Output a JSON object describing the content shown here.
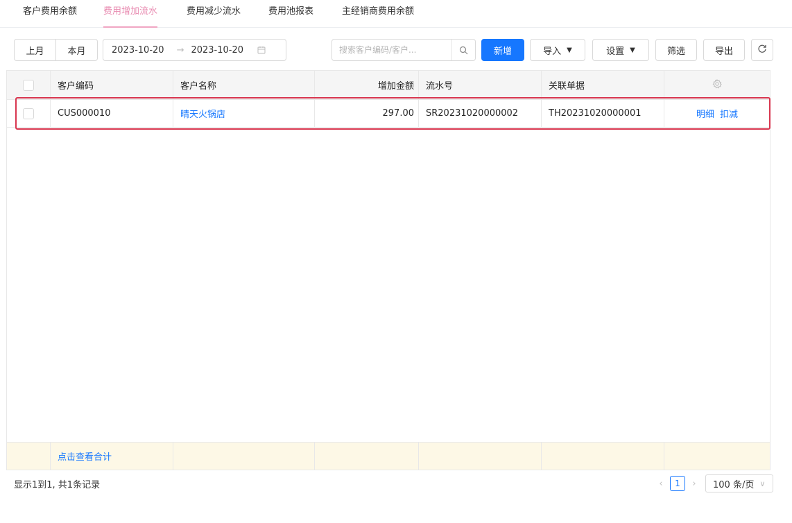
{
  "tabs": [
    {
      "label": "客户费用余额",
      "active": false
    },
    {
      "label": "费用增加流水",
      "active": true
    },
    {
      "label": "费用减少流水",
      "active": false
    },
    {
      "label": "费用池报表",
      "active": false
    },
    {
      "label": "主经销商费用余额",
      "active": false
    }
  ],
  "toolbar": {
    "prev_month": "上月",
    "this_month": "本月",
    "date_start": "2023-10-20",
    "date_sep": "→",
    "date_end": "2023-10-20",
    "search_placeholder": "搜索客户编码/客户...",
    "add_label": "新增",
    "import_label": "导入",
    "settings_label": "设置",
    "filter_label": "筛选",
    "export_label": "导出"
  },
  "table": {
    "columns": [
      "客户编码",
      "客户名称",
      "增加金额",
      "流水号",
      "关联单据"
    ],
    "rows": [
      {
        "customer_code": "CUS000010",
        "customer_name": "晴天火锅店",
        "amount": "297.00",
        "serial_no": "SR20231020000002",
        "related_doc": "TH20231020000001",
        "action_detail": "明细",
        "action_deduct": "扣减"
      }
    ],
    "footer_link": "点击查看合计"
  },
  "pagination": {
    "info": "显示1到1, 共1条记录",
    "current_page": "1",
    "page_size": "100 条/页"
  },
  "colors": {
    "primary": "#1677ff",
    "active_tab": "#e88ab0",
    "highlight_border": "#d8364f",
    "footer_bg": "#fdf8e6"
  }
}
